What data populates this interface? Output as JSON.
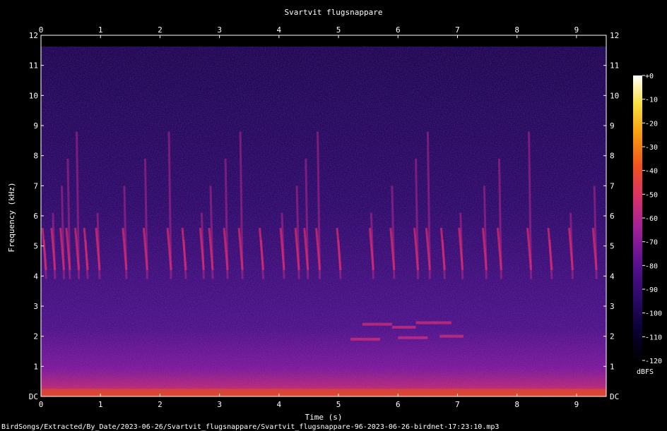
{
  "chart_data": {
    "type": "heatmap",
    "title": "Svartvit flugsnappare",
    "xlabel": "Time (s)",
    "ylabel": "Frequency (kHz)",
    "xlim": [
      0,
      9.5
    ],
    "ylim": [
      0,
      12
    ],
    "x_ticks": [
      "0",
      "1",
      "2",
      "3",
      "4",
      "5",
      "6",
      "7",
      "8",
      "9"
    ],
    "y_ticks": [
      "DC",
      "1",
      "2",
      "3",
      "4",
      "5",
      "6",
      "7",
      "8",
      "9",
      "10",
      "11",
      "12"
    ],
    "colorbar": {
      "label": "dBFS",
      "range": [
        -120,
        0
      ],
      "ticks": [
        "+0",
        "-10",
        "-20",
        "-30",
        "-40",
        "-50",
        "-60",
        "-70",
        "-80",
        "-90",
        "-100",
        "-110",
        "-120"
      ]
    },
    "colormap": [
      "#000000",
      "#0a0030",
      "#2a0a6a",
      "#5a1090",
      "#a0209a",
      "#d8306a",
      "#f05020",
      "#f8a010",
      "#f8e040",
      "#ffffff"
    ]
  },
  "footer": {
    "file_path": "BirdSongs/Extracted/By_Date/2023-06-26/Svartvit_flugsnappare/Svartvit_flugsnappare-96-2023-06-26-birdnet-17:23:10.mp3"
  }
}
